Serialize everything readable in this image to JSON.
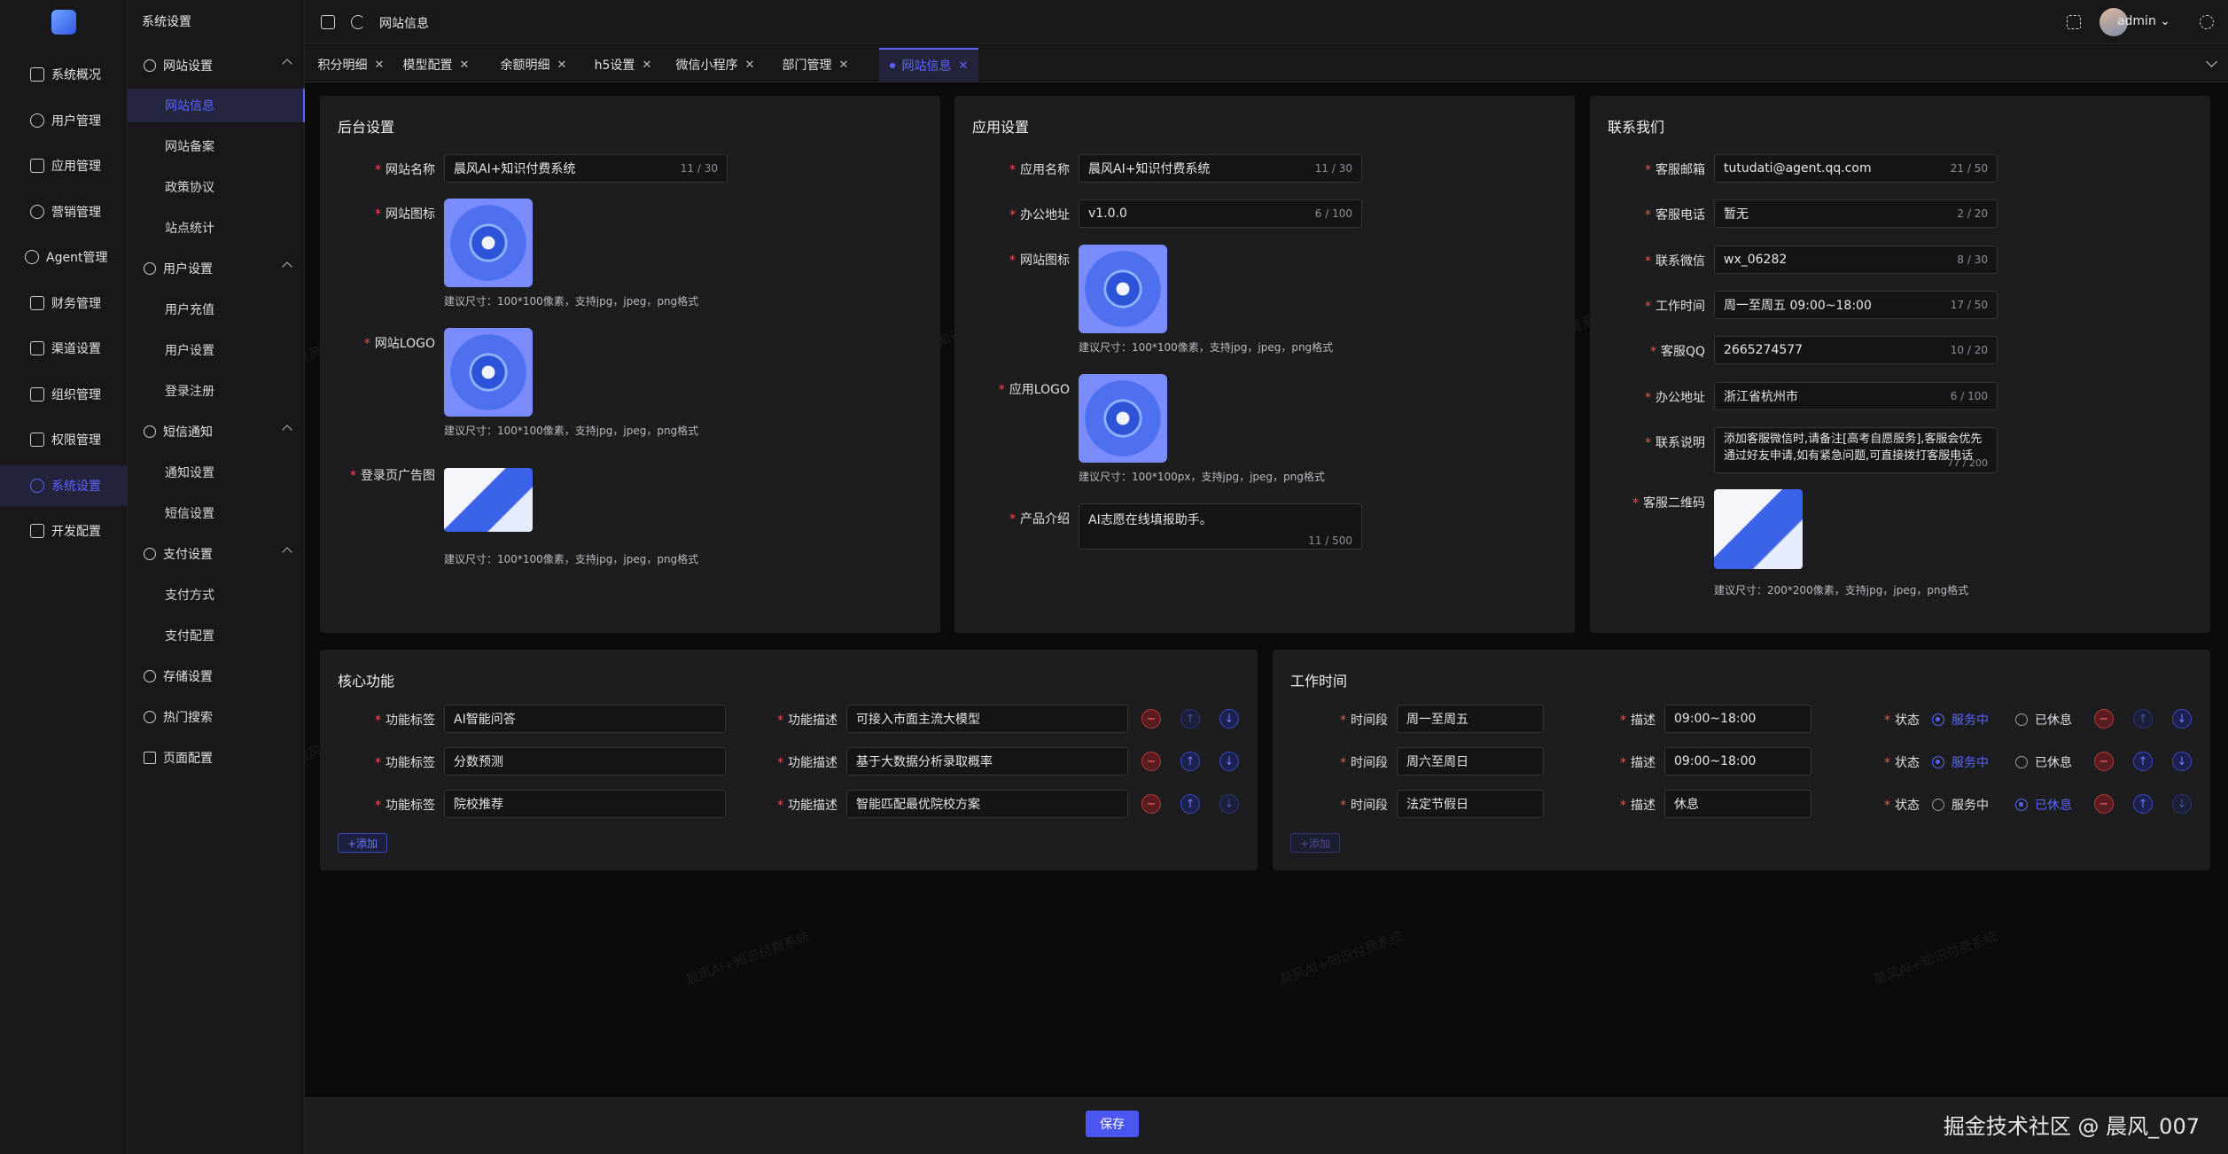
{
  "rail": {
    "items": [
      "系统概况",
      "用户管理",
      "应用管理",
      "营销管理",
      "Agent管理",
      "财务管理",
      "渠道设置",
      "组织管理",
      "权限管理",
      "系统设置",
      "开发配置"
    ]
  },
  "sub": {
    "title": "系统设置",
    "groups": {
      "website": "网站设置",
      "user": "用户设置",
      "sms": "短信通知",
      "pay": "支付设置",
      "storage": "存储设置",
      "search": "热门搜索",
      "page": "页面配置"
    },
    "items": {
      "site_info": "网站信息",
      "site_icp": "网站备案",
      "policy": "政策协议",
      "stats": "站点统计",
      "recharge": "用户充值",
      "user_settings": "用户设置",
      "login": "登录注册",
      "notify": "通知设置",
      "sms_set": "短信设置",
      "pay_method": "支付方式",
      "pay_config": "支付配置"
    }
  },
  "header": {
    "breadcrumb": "网站信息",
    "user": "admin ⌄"
  },
  "tabs": [
    "积分明细",
    "模型配置",
    "余额明细",
    "h5设置",
    "微信小程序",
    "部门管理",
    "网站信息"
  ],
  "backend": {
    "title": "后台设置",
    "site_name_label": "网站名称",
    "site_name_value": "晨风AI+知识付费系统",
    "site_name_count": "11 / 30",
    "site_icon_label": "网站图标",
    "site_icon_hint": "建议尺寸：100*100像素，支持jpg，jpeg，png格式",
    "site_logo_label": "网站LOGO",
    "site_logo_hint": "建议尺寸：100*100像素，支持jpg，jpeg，png格式",
    "login_ad_label": "登录页广告图",
    "login_ad_hint": "建议尺寸：100*100像素，支持jpg，jpeg，png格式"
  },
  "app": {
    "title": "应用设置",
    "app_name_label": "应用名称",
    "app_name_value": "晨风AI+知识付费系统",
    "app_name_count": "11 / 30",
    "office_label": "办公地址",
    "office_value": "v1.0.0",
    "office_count": "6 / 100",
    "icon_label": "网站图标",
    "icon_hint": "建议尺寸：100*100像素，支持jpg，jpeg，png格式",
    "logo_label": "应用LOGO",
    "logo_hint": "建议尺寸：100*100px，支持jpg，jpeg，png格式",
    "intro_label": "产品介绍",
    "intro_value": "AI志愿在线填报助手。",
    "intro_count": "11 / 500"
  },
  "contact": {
    "title": "联系我们",
    "email_label": "客服邮箱",
    "email_value": "tutudati@agent.qq.com",
    "email_count": "21 / 50",
    "phone_label": "客服电话",
    "phone_value": "暂无",
    "phone_count": "2 / 20",
    "wechat_label": "联系微信",
    "wechat_value": "wx_06282",
    "wechat_count": "8 / 30",
    "hours_label": "工作时间",
    "hours_value": "周一至周五 09:00~18:00",
    "hours_count": "17 / 50",
    "qq_label": "客服QQ",
    "qq_value": "2665274577",
    "qq_count": "10 / 20",
    "addr_label": "办公地址",
    "addr_value": "浙江省杭州市",
    "addr_count": "6 / 100",
    "desc_label": "联系说明",
    "desc_value": "添加客服微信时,请备注[高考自愿服务],客服会优先通过好友申请,如有紧急问题,可直接拨打客服电话",
    "desc_count": "77 / 200",
    "qr_label": "客服二维码",
    "qr_hint": "建议尺寸：200*200像素，支持jpg，jpeg，png格式"
  },
  "core": {
    "title": "核心功能",
    "tag_label": "功能标签",
    "desc_label": "功能描述",
    "rows": [
      {
        "tag": "AI智能问答",
        "desc": "可接入市面主流大模型"
      },
      {
        "tag": "分数预测",
        "desc": "基于大数据分析录取概率"
      },
      {
        "tag": "院校推荐",
        "desc": "智能匹配最优院校方案"
      }
    ],
    "add": "+添加"
  },
  "work": {
    "title": "工作时间",
    "period_label": "时间段",
    "desc_label": "描述",
    "status_label": "状态",
    "opt_on": "服务中",
    "opt_off": "已休息",
    "rows": [
      {
        "period": "周一至周五",
        "desc": "09:00~18:00",
        "status": "on"
      },
      {
        "period": "周六至周日",
        "desc": "09:00~18:00",
        "status": "on"
      },
      {
        "period": "法定节假日",
        "desc": "休息",
        "status": "off"
      }
    ],
    "add": "+添加"
  },
  "footer": {
    "save": "保存",
    "credit": "掘金技术社区 @ 晨风_007"
  },
  "watermark": "晨风AI+知识付费系统"
}
